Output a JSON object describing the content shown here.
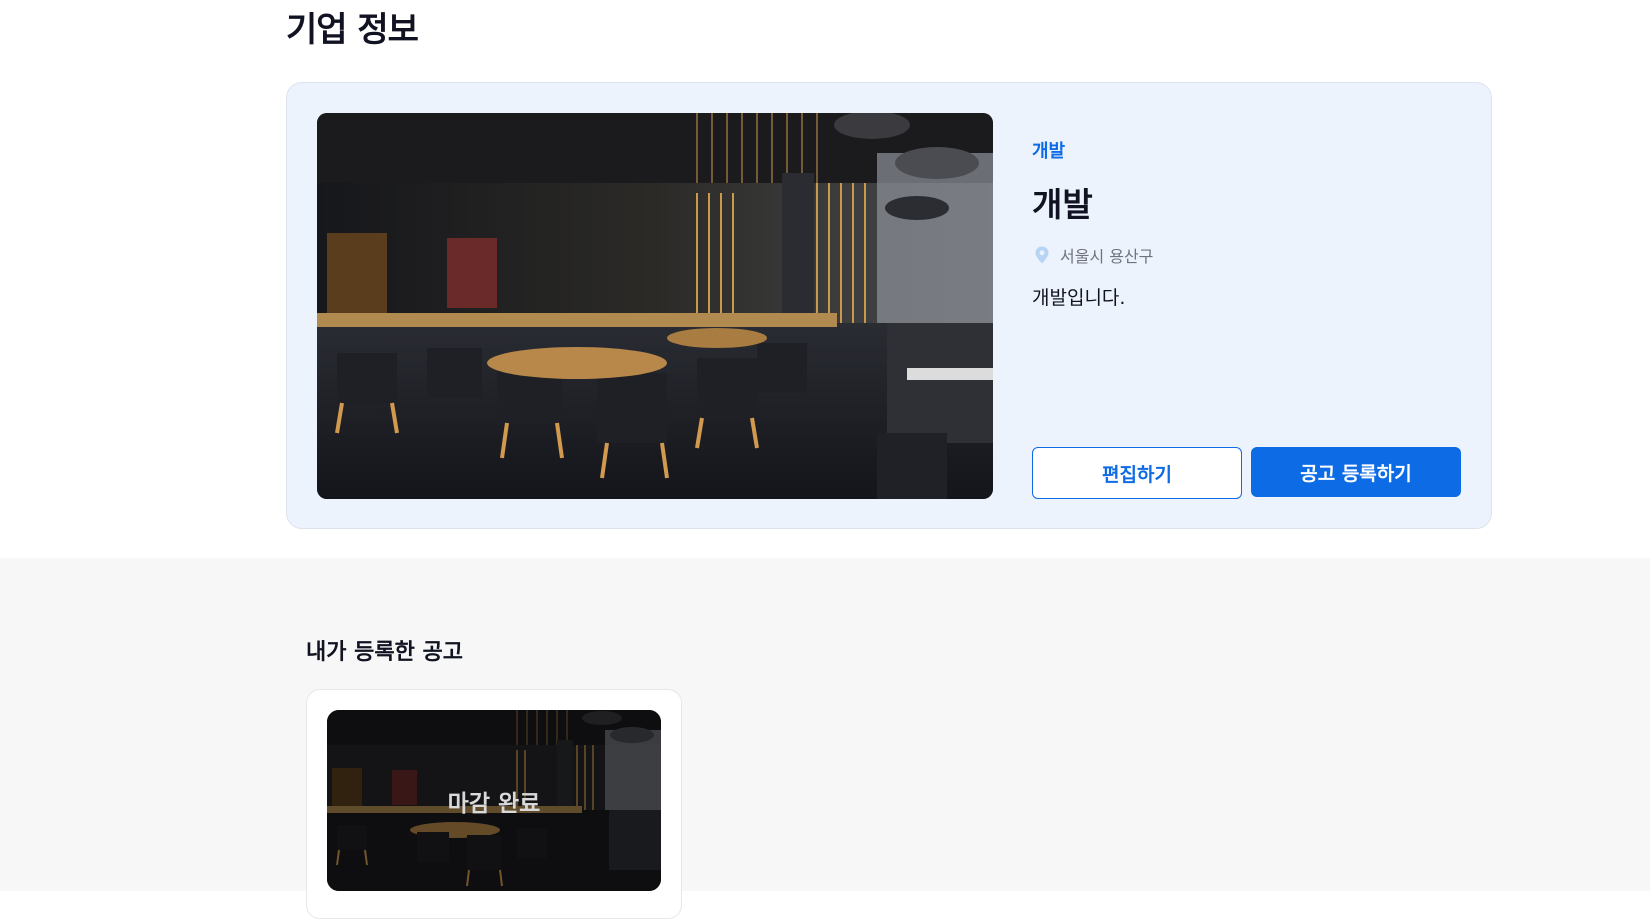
{
  "header": {
    "title": "기업 정보"
  },
  "company": {
    "category": "개발",
    "name": "개발",
    "location": "서울시 용산구",
    "description": "개발입니다.",
    "photo_alt": "restaurant-interior-photo",
    "actions": {
      "edit_label": "편집하기",
      "post_label": "공고 등록하기"
    }
  },
  "my_posts": {
    "title": "내가 등록한 공고",
    "items": [
      {
        "status": "마감 완료"
      }
    ]
  },
  "colors": {
    "accent": "#0d6ce5",
    "card_bg": "#edf3fc",
    "section_bg": "#f7f7f7",
    "muted_text": "#70737c",
    "pin": "#b8d4f5"
  },
  "icons": {
    "location": "map-pin-icon"
  }
}
